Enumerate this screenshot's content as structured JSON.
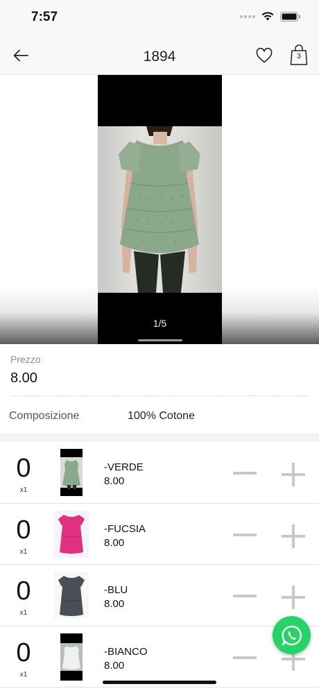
{
  "status_bar": {
    "time": "7:57"
  },
  "nav": {
    "title": "1894",
    "cart_count": "3"
  },
  "gallery": {
    "counter": "1/5"
  },
  "price": {
    "label": "Prezzo",
    "value": "8.00"
  },
  "composition": {
    "label": "Composizione",
    "value": "100% Cotone"
  },
  "variants": [
    {
      "qty": "0",
      "multiplier": "x1",
      "name": "-VERDE",
      "price": "8.00",
      "color": "#8aa88a"
    },
    {
      "qty": "0",
      "multiplier": "x1",
      "name": "-FUCSIA",
      "price": "8.00",
      "color": "#e0307f"
    },
    {
      "qty": "0",
      "multiplier": "x1",
      "name": "-BLU",
      "price": "8.00",
      "color": "#4a4e55"
    },
    {
      "qty": "0",
      "multiplier": "x1",
      "name": "-BIANCO",
      "price": "8.00",
      "color": "#eef0f2"
    }
  ],
  "icons": {
    "back": "arrow-left-icon",
    "favorite": "heart-icon",
    "cart": "shopping-bag-icon",
    "whatsapp": "whatsapp-icon",
    "minus": "minus-icon",
    "plus": "plus-icon"
  },
  "colors": {
    "whatsapp": "#25d366",
    "stepper": "#c8c8c8"
  }
}
